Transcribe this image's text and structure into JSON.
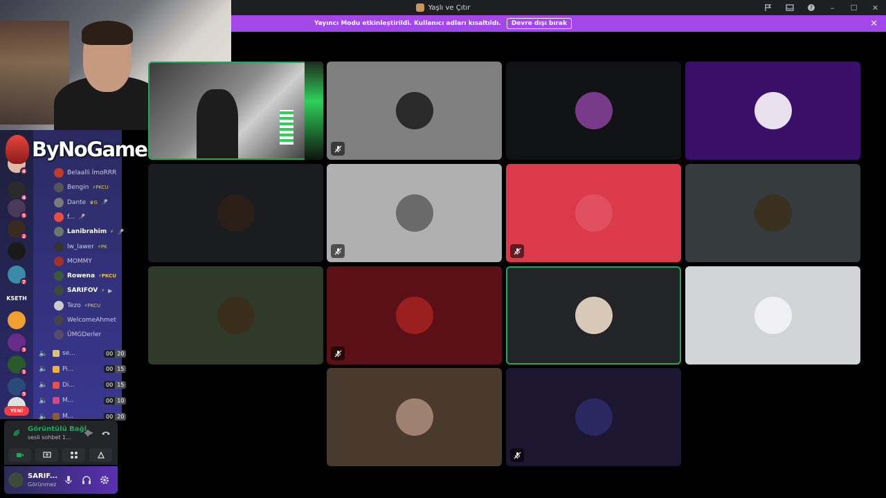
{
  "window": {
    "title": "Yaşlı ve Çıtır"
  },
  "banner": {
    "message": "Yayıncı Modu etkinleştirildi. Kullanıcı adları kısaltıldı.",
    "button_label": "Devre dışı bırak",
    "close_label": "✕"
  },
  "stream_overlay": {
    "brand_text": "ByNoGame"
  },
  "servers": [
    {
      "badge": "4",
      "color": "#e0b8a8"
    },
    {
      "badge": "4",
      "color": "#2a2a2a"
    },
    {
      "badge": "5",
      "color": "#4a3a5a"
    },
    {
      "badge": "2",
      "color": "#3a2a20"
    },
    {
      "badge": "",
      "color": "#1a1a1a"
    },
    {
      "badge": "7",
      "color": "#3a8aa8"
    },
    {
      "label": "KSETH"
    },
    {
      "badge": "",
      "color": "#f0a030"
    },
    {
      "badge": "3",
      "color": "#6a2a8a"
    },
    {
      "badge": "1",
      "color": "#2a5a2a"
    },
    {
      "badge": "3",
      "color": "#2a4a7a"
    },
    {
      "badge": "",
      "color": "#e0e0e0"
    }
  ],
  "new_badge": "YENİ",
  "members": [
    {
      "name": "Belaalli İmoRRR",
      "tag": "",
      "av": "#c0392b"
    },
    {
      "name": "Bengin",
      "tag": "⚡PKCU",
      "av": "#555"
    },
    {
      "name": "Dante",
      "tag": "♛G",
      "av": "#7a7a7a",
      "icon": "🎤̸"
    },
    {
      "name": "f...",
      "tag": "",
      "av": "#e74c3c",
      "icon": "🎤̸"
    },
    {
      "name": "Lanibrahim",
      "tag": "⚡",
      "av": "#6a7a6a",
      "bold": true,
      "icon": "🎤̸"
    },
    {
      "name": "lw_lawer",
      "tag": "⚡PK",
      "av": "#333"
    },
    {
      "name": "MOMMY",
      "tag": "",
      "av": "#a0302a"
    },
    {
      "name": "Rowena",
      "tag": "⚡PKCU",
      "av": "#3a5a3a",
      "bold": true
    },
    {
      "name": "SARIFOV",
      "tag": "⚡",
      "av": "#3d4a3a",
      "bold": true,
      "icon": "▶"
    },
    {
      "name": "Tezo",
      "tag": "⚡PKCU",
      "av": "#ccc"
    },
    {
      "name": "WelcomeAhmet",
      "tag": "",
      "av": "#444"
    },
    {
      "name": "ÜMGDerler",
      "tag": "",
      "av": "#5a4a6a"
    }
  ],
  "voice_channels": [
    {
      "name": "se...",
      "count": "00",
      "limit": "20",
      "emoji": "#d9c27a"
    },
    {
      "name": "Pi...",
      "count": "00",
      "limit": "15",
      "emoji": "#f0b040"
    },
    {
      "name": "Di...",
      "count": "00",
      "limit": "15",
      "emoji": "#e8504a"
    },
    {
      "name": "M...",
      "count": "00",
      "limit": "10",
      "emoji": "#d04a8a"
    },
    {
      "name": "M...",
      "count": "00",
      "limit": "20",
      "emoji": "#8a5a3a"
    }
  ],
  "voice_status": {
    "title": "Görüntülü Bağl",
    "subtitle": "sesli sohbet 1..."
  },
  "user": {
    "name": "SARIF...",
    "status": "Görünmez"
  },
  "tiles": [
    {
      "type": "camera",
      "speaking": true
    },
    {
      "bg": "#808080",
      "avatar": "#2a2a2a",
      "muted": true
    },
    {
      "bg": "#111214",
      "avatar": "#7a3a8a",
      "muted": false
    },
    {
      "bg": "#3a0f6a",
      "avatar": "#e8e0ec",
      "muted": false
    },
    {
      "bg": "#1a1c20",
      "avatar": "#2a1e16",
      "muted": false
    },
    {
      "bg": "#b0b0b0",
      "avatar": "#6a6a6a",
      "muted": true
    },
    {
      "bg": "#db3a4a",
      "avatar": "#e05060",
      "muted": true
    },
    {
      "bg": "#363b3e",
      "avatar": "#3a3020",
      "muted": false
    },
    {
      "bg": "#2f3a28",
      "avatar": "#3a2e1a",
      "muted": false
    },
    {
      "bg": "#5a1016",
      "avatar": "#9a2020",
      "muted": true
    },
    {
      "bg": "#232428",
      "avatar": "#d8c8b8",
      "muted": false,
      "speaking": true
    },
    {
      "bg": "#d3d4d6",
      "avatar": "#f0f0f4",
      "muted": false
    },
    {
      "bg": "#4a3a2e",
      "avatar": "#a08070",
      "muted": false
    },
    {
      "bg": "#1c1630",
      "avatar": "#2a2860",
      "muted": true
    }
  ]
}
